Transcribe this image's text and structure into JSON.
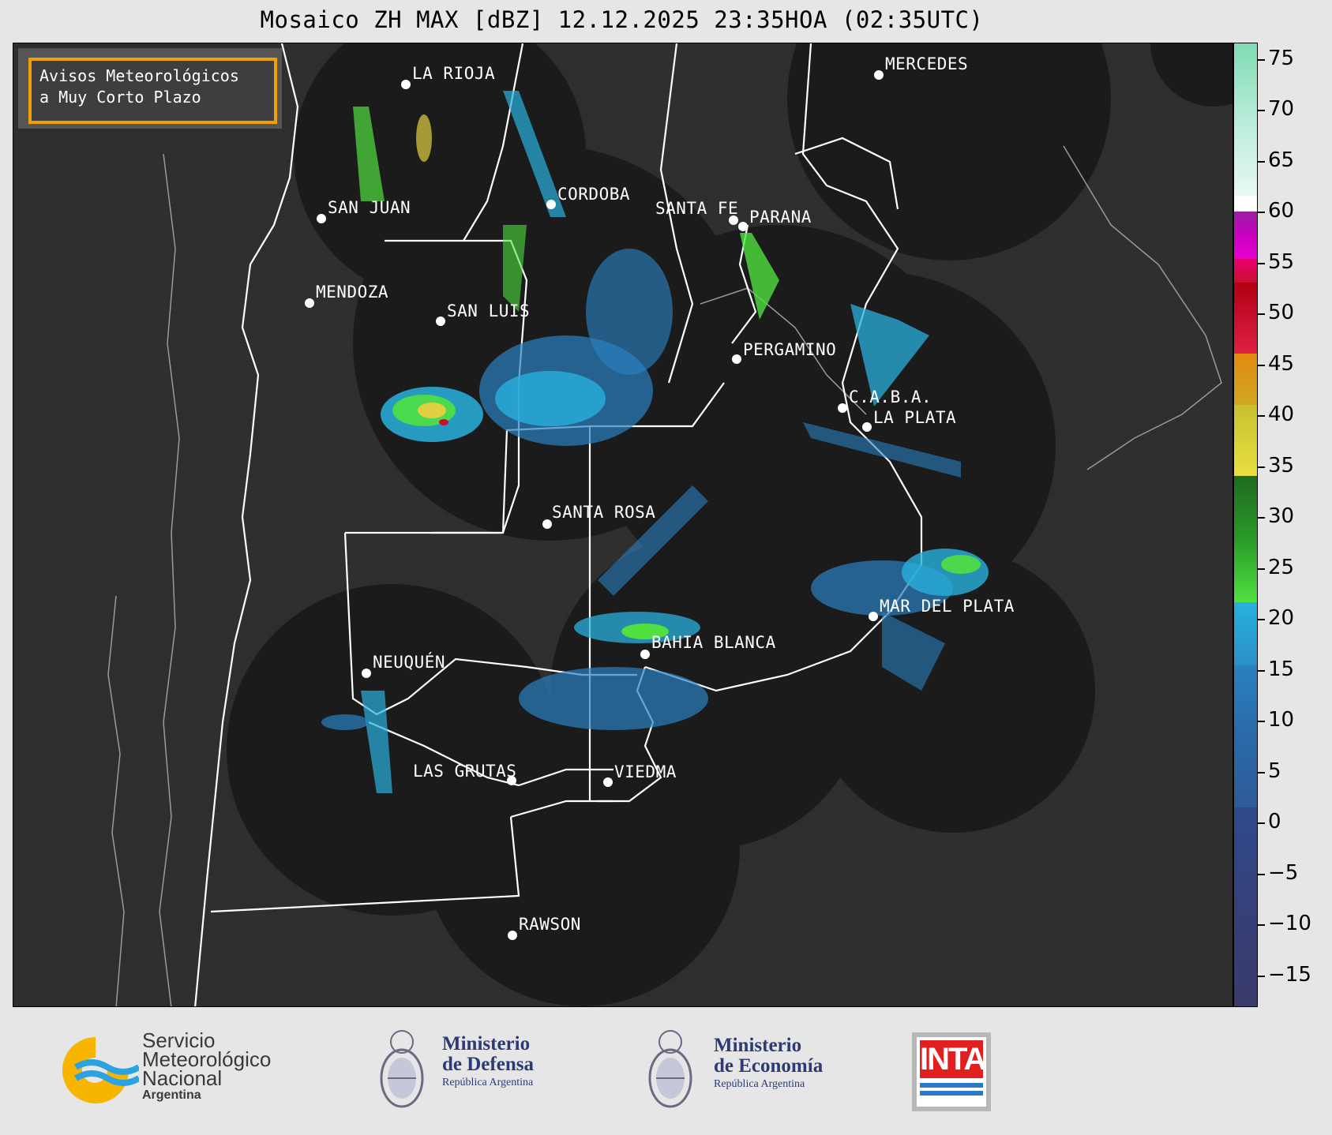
{
  "title": "Mosaico ZH MAX [dBZ] 12.12.2025 23:35HOA (02:35UTC)",
  "avisos": {
    "line1": "Avisos Meteorológicos",
    "line2": "a Muy Corto Plazo"
  },
  "cities": [
    {
      "name": "LA RIOJA"
    },
    {
      "name": "MERCEDES"
    },
    {
      "name": "SAN JUAN"
    },
    {
      "name": "CORDOBA"
    },
    {
      "name": "SANTA FE"
    },
    {
      "name": "PARANA"
    },
    {
      "name": "MENDOZA"
    },
    {
      "name": "SAN LUIS"
    },
    {
      "name": "PERGAMINO"
    },
    {
      "name": "C.A.B.A."
    },
    {
      "name": "LA PLATA"
    },
    {
      "name": "SANTA ROSA"
    },
    {
      "name": "MAR DEL PLATA"
    },
    {
      "name": "BAHIA BLANCA"
    },
    {
      "name": "NEUQUÉN"
    },
    {
      "name": "LAS GRUTAS"
    },
    {
      "name": "VIEDMA"
    },
    {
      "name": "RAWSON"
    }
  ],
  "colorbar": {
    "ticks": [
      "75",
      "70",
      "65",
      "60",
      "55",
      "50",
      "45",
      "40",
      "35",
      "30",
      "25",
      "20",
      "15",
      "10",
      "5",
      "0",
      "−5",
      "−10",
      "−15"
    ],
    "colors": {
      "cyan_high": "#7fdcb4",
      "white": "#ffffff",
      "purple": "#a020a0",
      "magenta": "#e000d0",
      "red": "#c8102e",
      "orange": "#e08a10",
      "yellow": "#e8e040",
      "green": "#2a9a28",
      "light_green": "#50e040",
      "light_blue": "#29b0dd",
      "blue": "#2a80c0",
      "dark_blue": "#2e4a8a"
    }
  },
  "logos": {
    "smn": {
      "line1": "Servicio",
      "line2": "Meteorológico",
      "line3": "Nacional",
      "line4": "Argentina"
    },
    "defensa": {
      "line1": "Ministerio",
      "line2": "de Defensa",
      "line3": "República Argentina"
    },
    "economia": {
      "line1": "Ministerio",
      "line2": "de Economía",
      "line3": "República Argentina"
    },
    "inta": {
      "text": "INTA"
    }
  }
}
